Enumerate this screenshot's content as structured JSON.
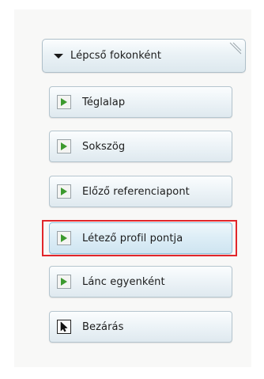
{
  "header": {
    "label": "Lépcső fokonként",
    "icon": "collapse-triangle-icon"
  },
  "buttons": [
    {
      "label": "Téglalap",
      "icon": "play-arrow-icon",
      "color": "#3d9a2e"
    },
    {
      "label": "Sokszög",
      "icon": "play-arrow-icon",
      "color": "#3d9a2e"
    },
    {
      "label": "Előző referenciapont",
      "icon": "play-arrow-icon",
      "color": "#3d9a2e"
    },
    {
      "label": "Létező profil pontja",
      "icon": "play-arrow-icon",
      "color": "#3d9a2e",
      "state": "selected"
    },
    {
      "label": "Lánc egyenként",
      "icon": "play-arrow-icon",
      "color": "#3d9a2e"
    },
    {
      "label": "Bezárás",
      "icon": "cursor-arrow-icon"
    }
  ],
  "highlight_color": "#e1262b"
}
